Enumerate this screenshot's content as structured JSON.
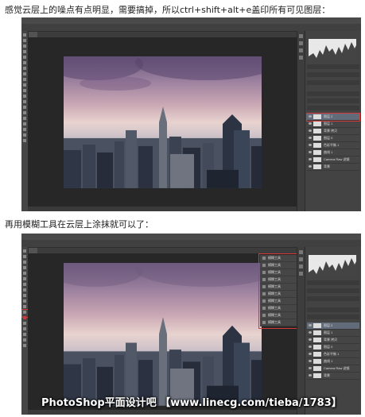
{
  "captions": {
    "first": "感觉云层上的噪点有点明显，需要搞掉，所以ctrl+shift+alt+e盖印所有可见图层：",
    "second": "再用模糊工具在云层上涂抹就可以了："
  },
  "watermark": "PhotoShop平面设计吧 【www.linecg.com/tieba/1783】",
  "accent_colors": {
    "highlight_box": "#d23a3a",
    "ui_dark": "#3c3c3c",
    "selected_layer": "#626b7a"
  },
  "screenshots": [
    {
      "layers": [
        "图层 2",
        "图层 1",
        "背景 拷贝",
        "图层 0",
        "色彩平衡 1",
        "曲线 1",
        "Camera Raw 滤镜",
        "背景"
      ],
      "selected_layer": "图层 2"
    },
    {
      "layers": [
        "图层 2",
        "图层 1",
        "背景 拷贝",
        "图层 0",
        "色彩平衡 1",
        "曲线 1",
        "Camera Raw 滤镜",
        "背景"
      ],
      "history_items": [
        "模糊工具",
        "模糊工具",
        "模糊工具",
        "模糊工具",
        "模糊工具",
        "模糊工具",
        "模糊工具",
        "模糊工具",
        "模糊工具",
        "模糊工具"
      ],
      "active_tool": "blur-tool"
    }
  ]
}
